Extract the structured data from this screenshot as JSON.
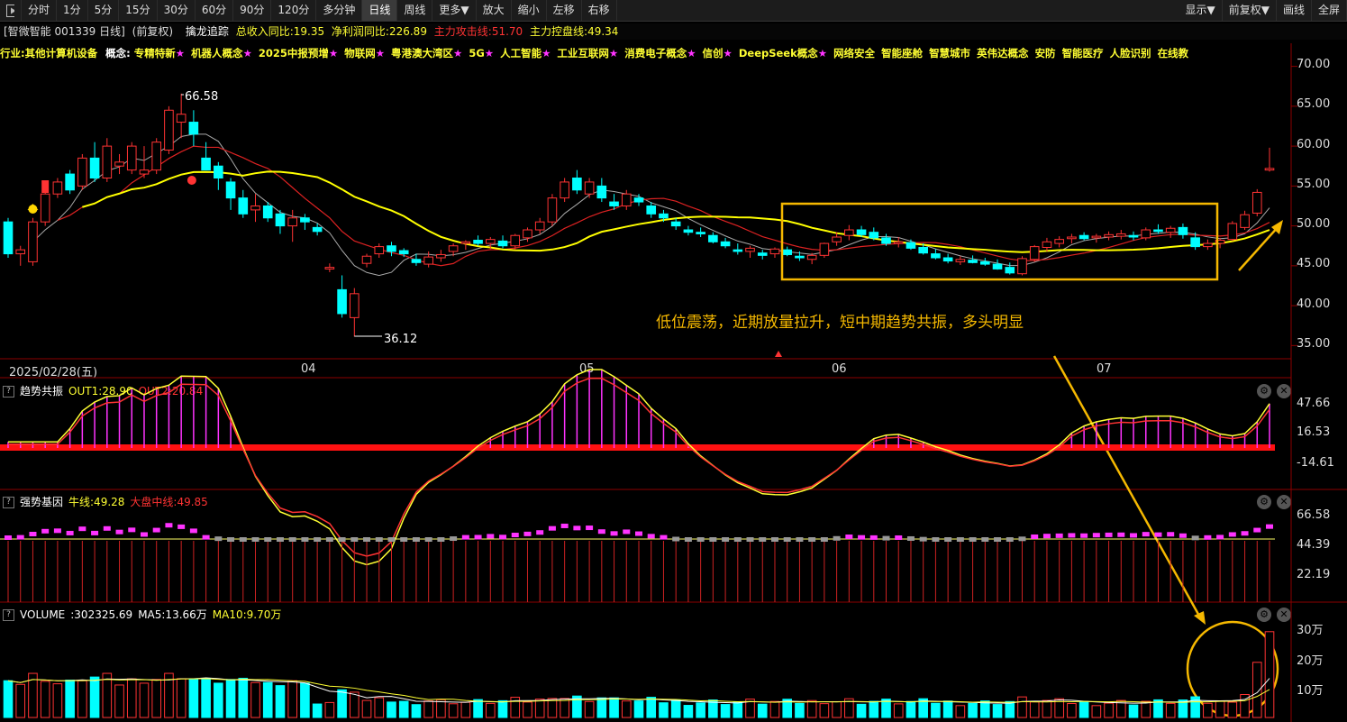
{
  "toolbar": {
    "items": [
      "分时",
      "1分",
      "5分",
      "15分",
      "30分",
      "60分",
      "90分",
      "120分",
      "多分钟",
      "日线",
      "周线",
      "更多▼",
      "放大",
      "缩小",
      "左移",
      "右移"
    ],
    "active": "日线",
    "right_items": [
      "显示▼",
      "前复权▼",
      "画线",
      "全屏"
    ]
  },
  "info": {
    "stock": "[智微智能 001339 日线]",
    "adjust": "(前复权)",
    "indicator": "擒龙追踪",
    "revenue": "总收入同比:19.35",
    "profit": "净利润同比:226.89",
    "attack": "主力攻击线:51.70",
    "control": "主力控盘线:49.34"
  },
  "concepts": {
    "industry_label": "行业:",
    "industry": "其他计算机设备",
    "concept_label": "概念:",
    "items": [
      {
        "name": "专精特新",
        "star": "★"
      },
      {
        "name": "机器人概念",
        "star": "★"
      },
      {
        "name": "2025中报预增",
        "star": "★"
      },
      {
        "name": "物联网",
        "star": "★"
      },
      {
        "name": "粤港澳大湾区",
        "star": "★"
      },
      {
        "name": "5G",
        "star": "★"
      },
      {
        "name": "人工智能",
        "star": "★"
      },
      {
        "name": "工业互联网",
        "star": "★"
      },
      {
        "name": "消费电子概念",
        "star": "★"
      },
      {
        "name": "信创",
        "star": "★"
      },
      {
        "name": "DeepSeek概念",
        "star": "★"
      },
      {
        "name": "网络安全",
        "star": ""
      },
      {
        "name": "智能座舱",
        "star": ""
      },
      {
        "name": "智慧城市",
        "star": ""
      },
      {
        "name": "英伟达概念",
        "star": ""
      },
      {
        "name": "安防",
        "star": ""
      },
      {
        "name": "智能医疗",
        "star": ""
      },
      {
        "name": "人脸识别",
        "star": ""
      },
      {
        "name": "在线教",
        "star": ""
      }
    ]
  },
  "main_chart": {
    "price_axis": [
      "70.00",
      "65.00",
      "60.00",
      "55.00",
      "50.00",
      "45.00",
      "40.00",
      "35.00"
    ],
    "high_label": "66.58",
    "low_label": "36.12",
    "start_date": "2025/02/28(五)",
    "months": [
      "04",
      "05",
      "06",
      "07"
    ],
    "annotation": "低位震荡，近期放量拉升，短中期趋势共振，多头明显"
  },
  "panel_trend": {
    "name": "趋势共振",
    "out1": "OUT1:28.90",
    "out2": "OUT2:20.84",
    "axis": [
      "47.66",
      "16.53",
      "-14.61"
    ]
  },
  "panel_gene": {
    "name": "强势基因",
    "bull": "牛线:49.28",
    "mid": "大盘中线:49.85",
    "axis": [
      "66.58",
      "44.39",
      "22.19"
    ]
  },
  "panel_volume": {
    "name": "VOLUME",
    "vol": ":302325.69",
    "ma5": "MA5:13.66万",
    "ma10": "MA10:9.70万",
    "axis": [
      "30万",
      "20万",
      "10万"
    ]
  },
  "colors": {
    "up": "#ff3333",
    "down": "#00ffff",
    "ma_yellow": "#ffff00",
    "ma_red": "#dd2222",
    "ma_gray": "#aaaaaa",
    "annotation": "#f5b800"
  },
  "chart_data": {
    "type": "candlestick",
    "ohlc": [
      [
        50.5,
        51.0,
        46.0,
        46.5
      ],
      [
        46.5,
        47.5,
        45.0,
        47.0
      ],
      [
        45.5,
        51.0,
        45.0,
        50.5
      ],
      [
        50.5,
        54.5,
        50.0,
        54.0
      ],
      [
        54.0,
        56.0,
        53.5,
        55.5
      ],
      [
        56.5,
        57.0,
        54.0,
        54.5
      ],
      [
        55.0,
        59.0,
        54.5,
        58.5
      ],
      [
        58.5,
        60.5,
        55.5,
        56.0
      ],
      [
        56.0,
        61.0,
        55.5,
        60.0
      ],
      [
        57.5,
        59.0,
        56.5,
        58.0
      ],
      [
        57.0,
        60.5,
        56.5,
        60.0
      ],
      [
        56.5,
        60.0,
        56.0,
        57.0
      ],
      [
        57.0,
        61.0,
        56.5,
        60.5
      ],
      [
        59.5,
        65.0,
        59.0,
        64.5
      ],
      [
        63.0,
        66.58,
        61.0,
        64.0
      ],
      [
        63.0,
        64.5,
        60.0,
        61.5
      ],
      [
        58.5,
        60.5,
        57.0,
        57.0
      ],
      [
        57.5,
        58.0,
        54.5,
        56.0
      ],
      [
        55.5,
        56.0,
        52.0,
        53.5
      ],
      [
        53.5,
        54.5,
        51.0,
        51.5
      ],
      [
        52.0,
        54.0,
        50.5,
        52.5
      ],
      [
        52.5,
        53.0,
        50.5,
        51.0
      ],
      [
        51.5,
        52.0,
        49.0,
        50.0
      ],
      [
        50.0,
        52.0,
        48.0,
        51.0
      ],
      [
        51.0,
        51.5,
        49.5,
        50.5
      ],
      [
        49.8,
        50.3,
        48.8,
        49.3
      ],
      [
        44.6,
        45.3,
        44.2,
        44.8
      ],
      [
        42.0,
        43.8,
        38.5,
        39.0
      ],
      [
        38.5,
        42.2,
        36.12,
        41.5
      ],
      [
        45.3,
        46.5,
        44.8,
        46.2
      ],
      [
        46.5,
        47.8,
        46.0,
        47.4
      ],
      [
        47.5,
        48.0,
        46.2,
        46.8
      ],
      [
        46.9,
        47.2,
        46.1,
        46.5
      ],
      [
        45.8,
        46.5,
        45.0,
        45.4
      ],
      [
        45.2,
        46.8,
        44.8,
        46.1
      ],
      [
        46.0,
        47.0,
        45.5,
        46.4
      ],
      [
        46.8,
        47.8,
        46.2,
        47.5
      ],
      [
        47.8,
        48.2,
        47.0,
        48.0
      ],
      [
        48.2,
        48.8,
        47.5,
        47.8
      ],
      [
        47.8,
        48.6,
        47.1,
        48.3
      ],
      [
        48.1,
        48.8,
        47.2,
        47.5
      ],
      [
        47.5,
        49.0,
        47.0,
        48.8
      ],
      [
        48.5,
        49.8,
        48.0,
        49.5
      ],
      [
        49.5,
        51.0,
        49.0,
        50.5
      ],
      [
        50.5,
        54.0,
        50.0,
        53.5
      ],
      [
        53.5,
        56.0,
        53.0,
        55.5
      ],
      [
        56.0,
        57.0,
        54.0,
        54.5
      ],
      [
        54.0,
        56.0,
        53.5,
        55.5
      ],
      [
        55.0,
        56.0,
        53.0,
        53.5
      ],
      [
        53.0,
        54.0,
        52.0,
        52.5
      ],
      [
        52.5,
        54.5,
        52.0,
        54.0
      ],
      [
        53.5,
        54.0,
        52.5,
        53.0
      ],
      [
        52.5,
        53.0,
        51.0,
        51.5
      ],
      [
        51.5,
        52.0,
        50.5,
        51.0
      ],
      [
        50.5,
        51.0,
        49.5,
        50.0
      ],
      [
        49.5,
        50.0,
        48.8,
        49.2
      ],
      [
        49.2,
        49.8,
        48.6,
        49.0
      ],
      [
        48.8,
        49.2,
        47.8,
        48.0
      ],
      [
        48.0,
        48.5,
        47.2,
        47.5
      ],
      [
        47.0,
        47.8,
        46.4,
        46.8
      ],
      [
        46.8,
        47.5,
        46.0,
        47.2
      ],
      [
        46.6,
        47.0,
        45.8,
        46.3
      ],
      [
        46.5,
        47.3,
        46.0,
        47.1
      ],
      [
        47.0,
        47.4,
        46.2,
        46.4
      ],
      [
        46.2,
        46.8,
        45.6,
        46.0
      ],
      [
        45.8,
        46.6,
        45.2,
        46.3
      ],
      [
        46.3,
        47.9,
        46.0,
        47.8
      ],
      [
        48.0,
        49.2,
        47.5,
        48.6
      ],
      [
        48.8,
        50.1,
        48.2,
        49.5
      ],
      [
        49.5,
        50.0,
        48.6,
        48.9
      ],
      [
        49.2,
        49.8,
        48.2,
        48.5
      ],
      [
        48.5,
        49.0,
        47.5,
        47.8
      ],
      [
        47.8,
        48.6,
        47.3,
        48.0
      ],
      [
        47.9,
        48.3,
        47.0,
        47.2
      ],
      [
        47.3,
        47.8,
        46.4,
        46.6
      ],
      [
        46.5,
        47.1,
        45.8,
        46.0
      ],
      [
        46.0,
        46.5,
        45.3,
        45.6
      ],
      [
        45.5,
        46.2,
        45.1,
        45.8
      ],
      [
        45.7,
        46.3,
        45.3,
        45.4
      ],
      [
        45.5,
        46.0,
        45.0,
        45.2
      ],
      [
        45.2,
        45.8,
        44.5,
        44.6
      ],
      [
        44.8,
        45.4,
        43.9,
        44.1
      ],
      [
        44.0,
        46.2,
        43.8,
        45.9
      ],
      [
        45.8,
        47.6,
        45.5,
        47.4
      ],
      [
        47.3,
        48.5,
        46.8,
        48.0
      ],
      [
        47.8,
        48.7,
        47.3,
        48.3
      ],
      [
        48.4,
        49.0,
        47.8,
        48.6
      ],
      [
        48.8,
        49.2,
        48.2,
        48.4
      ],
      [
        48.5,
        49.0,
        47.9,
        48.7
      ],
      [
        48.6,
        49.3,
        48.2,
        48.9
      ],
      [
        48.7,
        49.5,
        48.3,
        49.0
      ],
      [
        48.8,
        49.3,
        48.2,
        48.6
      ],
      [
        48.5,
        49.8,
        48.2,
        49.5
      ],
      [
        49.5,
        50.2,
        49.0,
        49.3
      ],
      [
        49.2,
        50.0,
        48.5,
        49.7
      ],
      [
        49.8,
        50.3,
        48.4,
        48.9
      ],
      [
        48.5,
        49.2,
        47.0,
        47.4
      ],
      [
        47.4,
        48.3,
        47.0,
        47.8
      ],
      [
        47.8,
        48.5,
        47.2,
        48.2
      ],
      [
        48.3,
        50.6,
        48.1,
        50.3
      ],
      [
        49.8,
        51.9,
        49.5,
        51.4
      ],
      [
        51.6,
        54.6,
        51.2,
        54.2
      ],
      [
        57.0,
        59.8,
        56.8,
        57.2
      ]
    ],
    "ranges": {
      "price": [
        34.5,
        71.5
      ]
    }
  }
}
